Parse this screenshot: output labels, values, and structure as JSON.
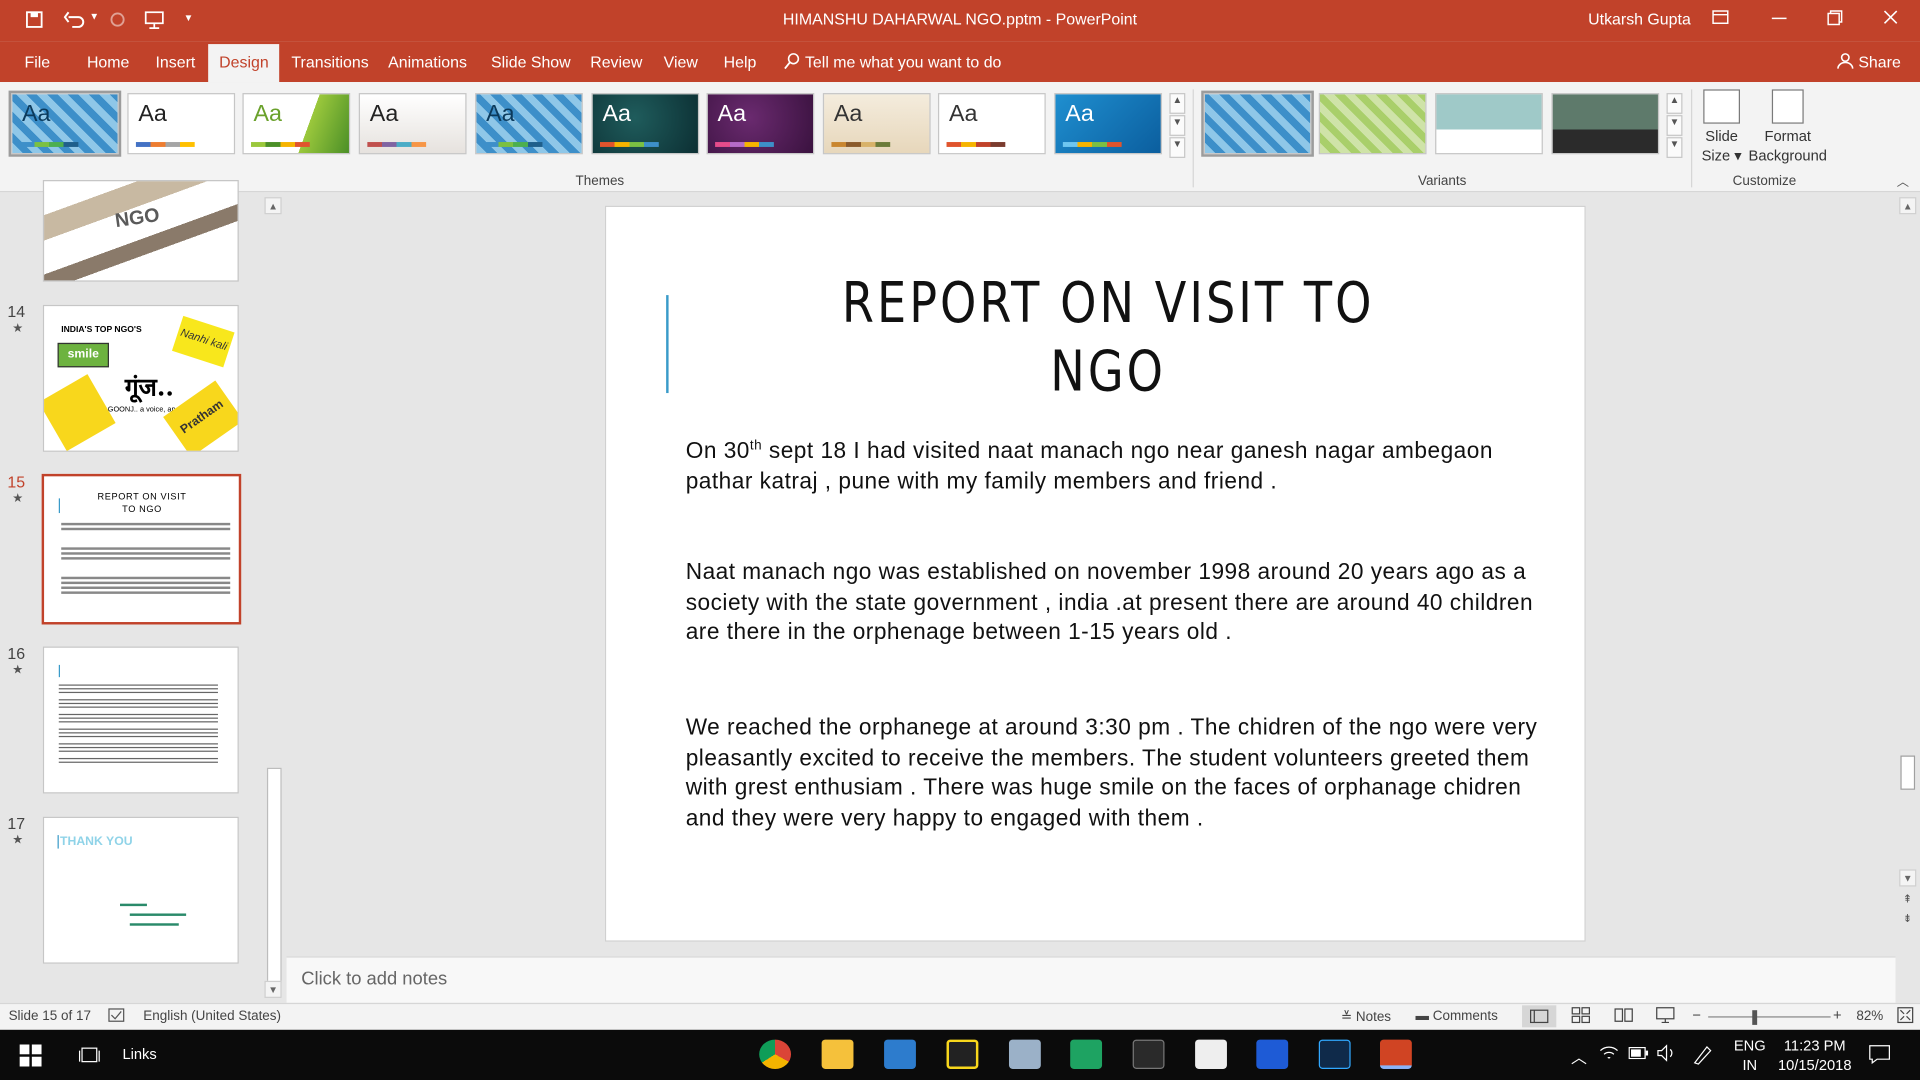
{
  "window": {
    "doc_title": "HIMANSHU DAHARWAL NGO.pptm  -  PowerPoint",
    "user": "Utkarsh Gupta"
  },
  "tabs": [
    "File",
    "Home",
    "Insert",
    "Design",
    "Transitions",
    "Animations",
    "Slide Show",
    "Review",
    "View",
    "Help"
  ],
  "active_tab": "Design",
  "tell_me": "Tell me what you want to do",
  "share": "Share",
  "ribbon": {
    "themes_label": "Themes",
    "variants_label": "Variants",
    "customize_label": "Customize",
    "theme_sample": "Aa",
    "slide_size": [
      "Slide",
      "Size ▾"
    ],
    "format_background": [
      "Format",
      "Background"
    ]
  },
  "thumbnails": {
    "t14_title": "INDIA'S TOP NGO'S",
    "t14_logo1": "smile",
    "t14_goonj": "गूंज..",
    "t14_goonj_sub": "GOONJ.. a voice, an effort",
    "t14_pratham": "Pratham",
    "t14_nanhi": "Nanhi kali",
    "t15_title": "REPORT ON VISIT TO NGO",
    "t17_title": "THANK YOU",
    "numbers": [
      "14",
      "15",
      "16",
      "17"
    ],
    "star": "★"
  },
  "slide": {
    "title_line1": "REPORT ON VISIT TO",
    "title_line2": "NGO",
    "p1_a": "On  30",
    "p1_sup": "th",
    "p1_b": "  sept  18  I had visited  naat  manach  ngo  near  ganesh nagar ambegaon pathar katraj , pune with my family members and friend .",
    "p2": "Naat manach ngo was established on november 1998 around 20 years ago as a society with the state government , india .at present there are around 40 children are there in the orphenage between  1-15 years old .",
    "p3": "We reached the orphanege at around 3:30 pm .  The  chidren of the ngo were very pleasantly excited to receive the members. The student volunteers greeted them with grest enthusiam . There was huge smile on the faces of orphanage chidren and they were very happy to engaged with them ."
  },
  "notes_placeholder": "Click to add notes",
  "status": {
    "slide_of": "Slide 15 of 17",
    "language": "English (United States)",
    "notes": "Notes",
    "comments": "Comments",
    "zoom": "82%"
  },
  "taskbar": {
    "links": "Links",
    "lang1": "ENG",
    "lang2": "IN",
    "time": "11:23 PM",
    "date": "10/15/2018"
  },
  "colors": {
    "accent": "#c1422a",
    "title_accent": "#3a9bc9"
  }
}
